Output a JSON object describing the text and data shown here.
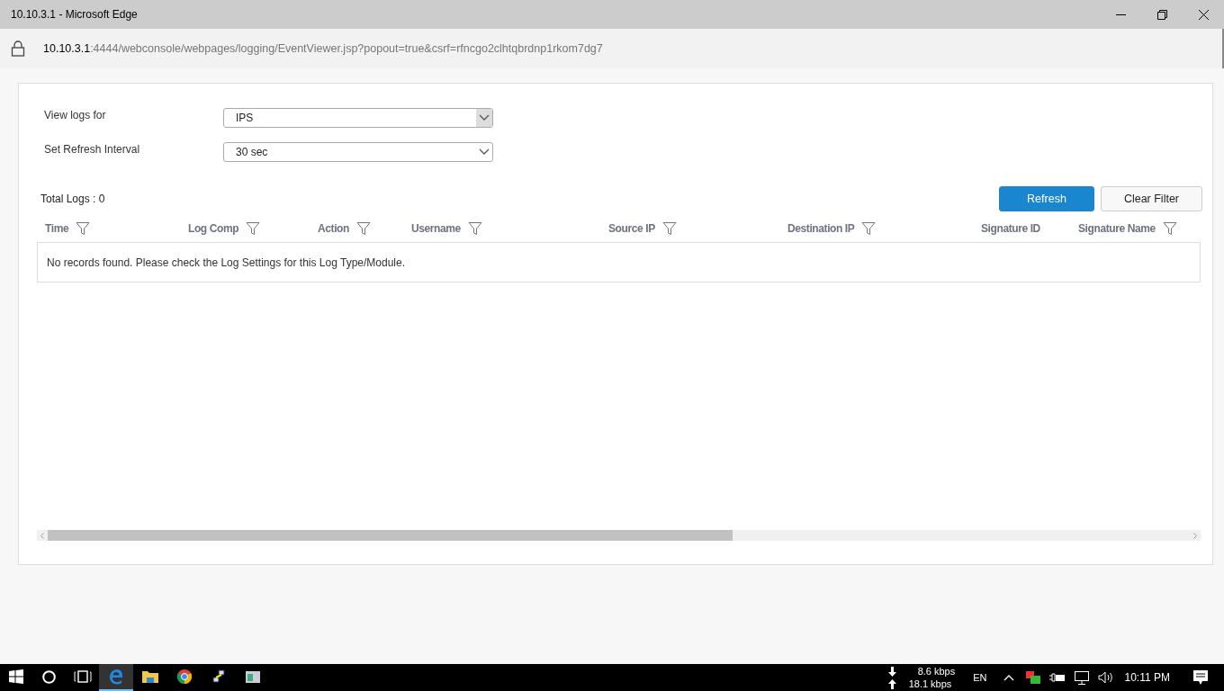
{
  "window": {
    "title": "10.10.3.1 - Microsoft Edge"
  },
  "address_bar": {
    "host": "10.10.3.1",
    "path": ":4444/webconsole/webpages/logging/EventViewer.jsp?popout=true&csrf=rfncgo2clhtqbrdnp1rkom7dg7"
  },
  "form": [
    {
      "label": "View logs for",
      "value": "IPS",
      "hovered": true
    },
    {
      "label": "Set Refresh Interval",
      "value": "30 sec",
      "hovered": false
    }
  ],
  "total_logs": "Total Logs : 0",
  "buttons": [
    {
      "label": "Refresh",
      "primary": true
    },
    {
      "label": "Clear Filter",
      "primary": false
    }
  ],
  "table": {
    "columns": [
      {
        "label": "Time",
        "filterable": true
      },
      {
        "label": "Log Comp",
        "filterable": true
      },
      {
        "label": "Action",
        "filterable": true
      },
      {
        "label": "Username",
        "filterable": true
      },
      {
        "label": "Source IP",
        "filterable": true
      },
      {
        "label": "Destination IP",
        "filterable": true
      },
      {
        "label": "Signature ID",
        "filterable": false
      },
      {
        "label": "Signature Name",
        "filterable": true
      }
    ],
    "empty_message": "No records found. Please check the Log Settings for this Log Type/Module.",
    "scrollbar": {
      "level": 0.6
    }
  },
  "taskbar": {
    "apps": [
      {
        "kind": "edge",
        "selected": true
      },
      {
        "kind": "folder",
        "selected": false
      },
      {
        "kind": "chrome",
        "selected": false
      },
      {
        "kind": "network",
        "selected": false
      },
      {
        "kind": "window",
        "selected": false
      }
    ],
    "download": "8.6 kbps",
    "upload": "18.1 kbps",
    "language": "EN",
    "time": "10:11 PM"
  }
}
